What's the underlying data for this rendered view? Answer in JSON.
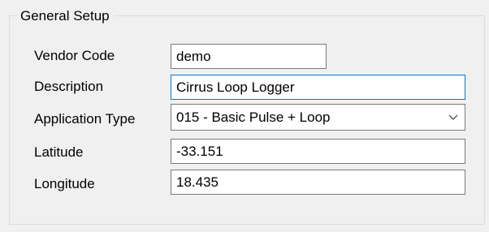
{
  "group": {
    "title": "General Setup"
  },
  "fields": {
    "vendor_code": {
      "label": "Vendor Code",
      "value": "demo"
    },
    "description": {
      "label": "Description",
      "value": "Cirrus Loop Logger"
    },
    "application_type": {
      "label": "Application Type",
      "value": "015 - Basic Pulse + Loop"
    },
    "latitude": {
      "label": "Latitude",
      "value": "-33.151"
    },
    "longitude": {
      "label": "Longitude",
      "value": "18.435"
    }
  },
  "icons": {
    "dropdown": "chevron-down-icon"
  },
  "colors": {
    "background": "#f0f0f0",
    "focus_border": "#0078d7",
    "field_border": "#7a7a7a"
  }
}
